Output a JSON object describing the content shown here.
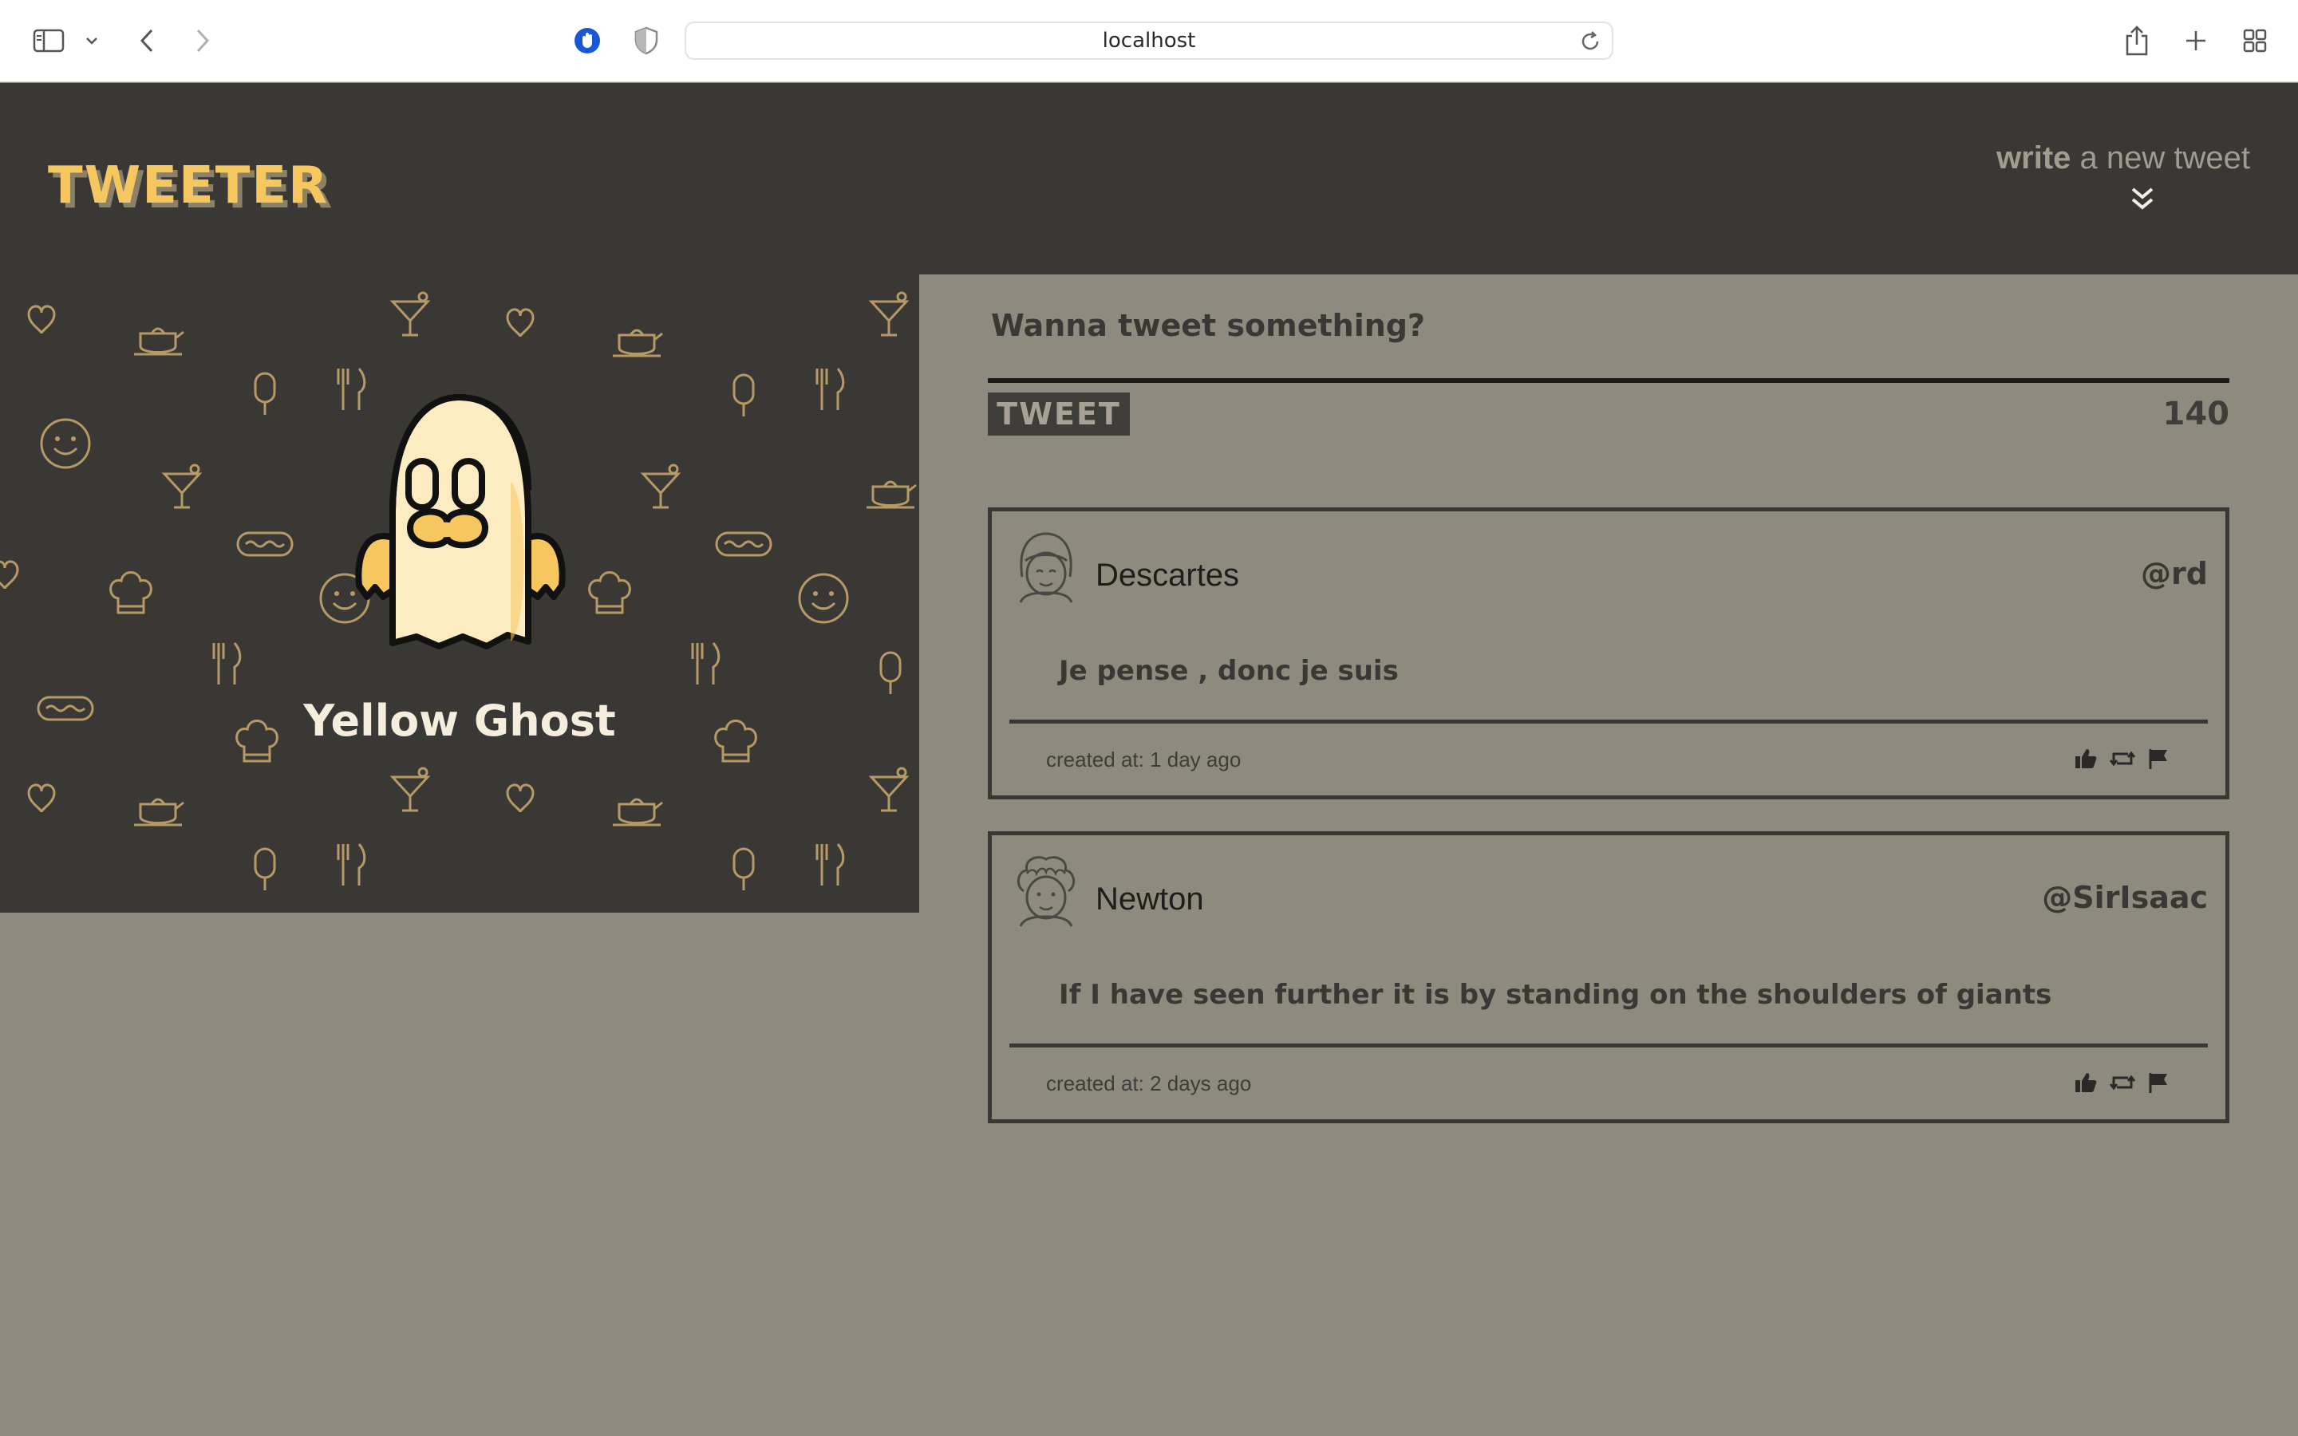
{
  "browser": {
    "url": "localhost"
  },
  "header": {
    "logo": "TWEETER",
    "compose_toggle_bold": "write",
    "compose_toggle_rest": " a new tweet"
  },
  "profile": {
    "name": "Yellow Ghost"
  },
  "compose": {
    "prompt": "Wanna tweet something?",
    "button_label": "TWEET",
    "counter": "140"
  },
  "tweets": [
    {
      "name": "Descartes",
      "handle": "@rd",
      "text": "Je pense , donc je suis",
      "created": "created at: 1 day ago"
    },
    {
      "name": "Newton",
      "handle": "@SirIsaac",
      "text": "If I have seen further it is by standing on the shoulders of giants",
      "created": "created at: 2 days ago"
    }
  ],
  "colors": {
    "background": "#8e8a7e",
    "dark": "#3a3835",
    "accent_yellow": "#f6c75e"
  }
}
